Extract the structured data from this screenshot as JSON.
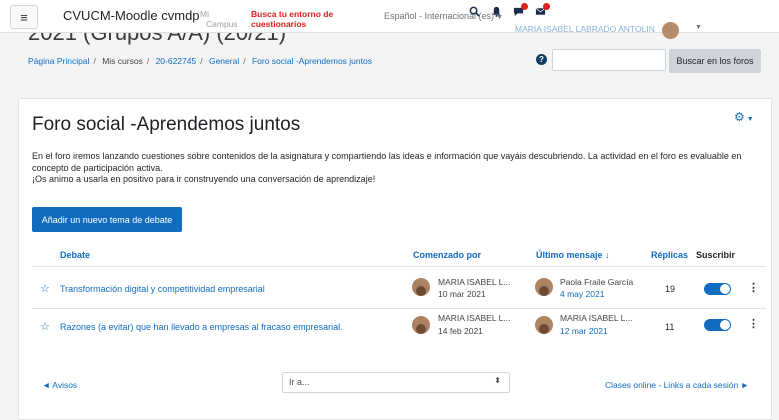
{
  "navbar": {
    "menu_icon": "hamburger-icon",
    "site_name": "CVUCM-Moodle cvmdp",
    "mi_campus": [
      "Mi",
      "Campus"
    ],
    "busca": "Busca tu entorno de cuestionarios",
    "language": "Español - Internacional (es)",
    "icons": [
      "search-icon",
      "bell-icon",
      "chat-icon",
      "mail-icon"
    ],
    "user_name": "MARIA ISABEL LABRADO ANTOLIN"
  },
  "header": {
    "course_title": "2021 (Grupos A/A) (20/21)",
    "breadcrumb": [
      "Página Principal",
      "Mis cursos",
      "20-622745",
      "General",
      "Foro social -Aprendemos juntos"
    ],
    "search_placeholder": "",
    "search_button": "Buscar en los foros"
  },
  "forum": {
    "title": "Foro social -Aprendemos juntos",
    "intro_lines": [
      "En el foro iremos lanzando cuestiones  sobre contenidos de la asignatura y compartiendo las ideas e información que vayáis descubriendo. La actividad en el foro es evaluable en concepto de participación activa.",
      "¡Os animo a usarla en positivo para ir construyendo una conversación de aprendizaje!"
    ],
    "add_button": "Añadir un nuevo tema de debate",
    "columns": {
      "debate": "Debate",
      "started_by": "Comenzado por",
      "last_post": "Último mensaje ↓",
      "replies": "Réplicas",
      "subscribe": "Suscribir"
    },
    "rows": [
      {
        "topic": "Transformación digital y competitividad empresarial",
        "author": "MARIA ISABEL L...",
        "started": "10 mar 2021",
        "last_author": "Paola Fraile García",
        "last_date": "4 may 2021",
        "replies": "19",
        "subscribed": true
      },
      {
        "topic": "Razones (a evitar) que han llevado a empresas al fracaso empresarial.",
        "author": "MARIA ISABEL L...",
        "started": "14 feb 2021",
        "last_author": "MARIA ISABEL L...",
        "last_date": "12 mar 2021",
        "replies": "11",
        "subscribed": true
      }
    ]
  },
  "footer": {
    "prev": "◄ Avisos",
    "jump_value": "Ir a...",
    "next": "Clases online - Links a cada sesión ►"
  }
}
